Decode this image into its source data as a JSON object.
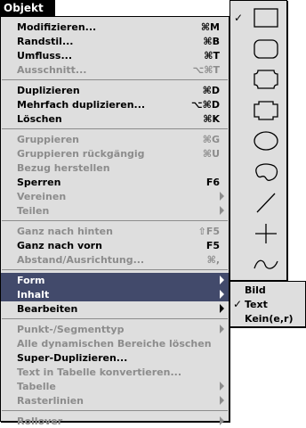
{
  "menu_title": "Objekt",
  "groups": [
    [
      {
        "label": "Modifizieren...",
        "shortcut": "⌘M",
        "enabled": true
      },
      {
        "label": "Randstil...",
        "shortcut": "⌘B",
        "enabled": true
      },
      {
        "label": "Umfluss...",
        "shortcut": "⌘T",
        "enabled": true
      },
      {
        "label": "Ausschnitt...",
        "shortcut": "⌥⌘T",
        "enabled": false
      }
    ],
    [
      {
        "label": "Duplizieren",
        "shortcut": "⌘D",
        "enabled": true
      },
      {
        "label": "Mehrfach duplizieren...",
        "shortcut": "⌥⌘D",
        "enabled": true
      },
      {
        "label": "Löschen",
        "shortcut": "⌘K",
        "enabled": true
      }
    ],
    [
      {
        "label": "Gruppieren",
        "shortcut": "⌘G",
        "enabled": false
      },
      {
        "label": "Gruppieren rückgängig",
        "shortcut": "⌘U",
        "enabled": false
      },
      {
        "label": "Bezug herstellen",
        "shortcut": "",
        "enabled": false
      },
      {
        "label": "Sperren",
        "shortcut": "F6",
        "enabled": true
      },
      {
        "label": "Vereinen",
        "submenu": true,
        "enabled": false
      },
      {
        "label": "Teilen",
        "submenu": true,
        "enabled": false
      }
    ],
    [
      {
        "label": "Ganz nach hinten",
        "shortcut": "⇧F5",
        "enabled": false
      },
      {
        "label": "Ganz nach vorn",
        "shortcut": "F5",
        "enabled": true
      },
      {
        "label": "Abstand/Ausrichtung...",
        "shortcut": "⌘,",
        "enabled": false
      }
    ],
    [
      {
        "label": "Form",
        "submenu": true,
        "enabled": true,
        "highlight": true
      },
      {
        "label": "Inhalt",
        "submenu": true,
        "enabled": true,
        "highlight": true
      },
      {
        "label": "Bearbeiten",
        "submenu": true,
        "enabled": true
      }
    ],
    [
      {
        "label": "Punkt-/Segmenttyp",
        "submenu": true,
        "enabled": false
      },
      {
        "label": "Alle dynamischen Bereiche löschen",
        "shortcut": "",
        "enabled": false
      },
      {
        "label": "Super-Duplizieren...",
        "shortcut": "",
        "enabled": true
      },
      {
        "label": "Text in Tabelle konvertieren...",
        "shortcut": "",
        "enabled": false
      },
      {
        "label": "Tabelle",
        "submenu": true,
        "enabled": false
      },
      {
        "label": "Rasterlinien",
        "submenu": true,
        "enabled": false
      }
    ],
    [
      {
        "label": "Rollover",
        "submenu": true,
        "enabled": false
      }
    ]
  ],
  "form_palette": {
    "shapes": [
      "rectangle",
      "rounded-rectangle",
      "concave-rectangle",
      "beveled-rectangle",
      "oval",
      "freehand-shape",
      "line",
      "orthogonal-line",
      "bezier-line"
    ],
    "checked_index": 0
  },
  "inhalt_submenu": [
    {
      "label": "Bild",
      "checked": false
    },
    {
      "label": "Text",
      "checked": true
    },
    {
      "label": "Kein(e,r)",
      "checked": false
    }
  ],
  "colors": {
    "menu_bg": "#dedede",
    "highlight": "#424a6b",
    "disabled": "#8c8c8c"
  }
}
